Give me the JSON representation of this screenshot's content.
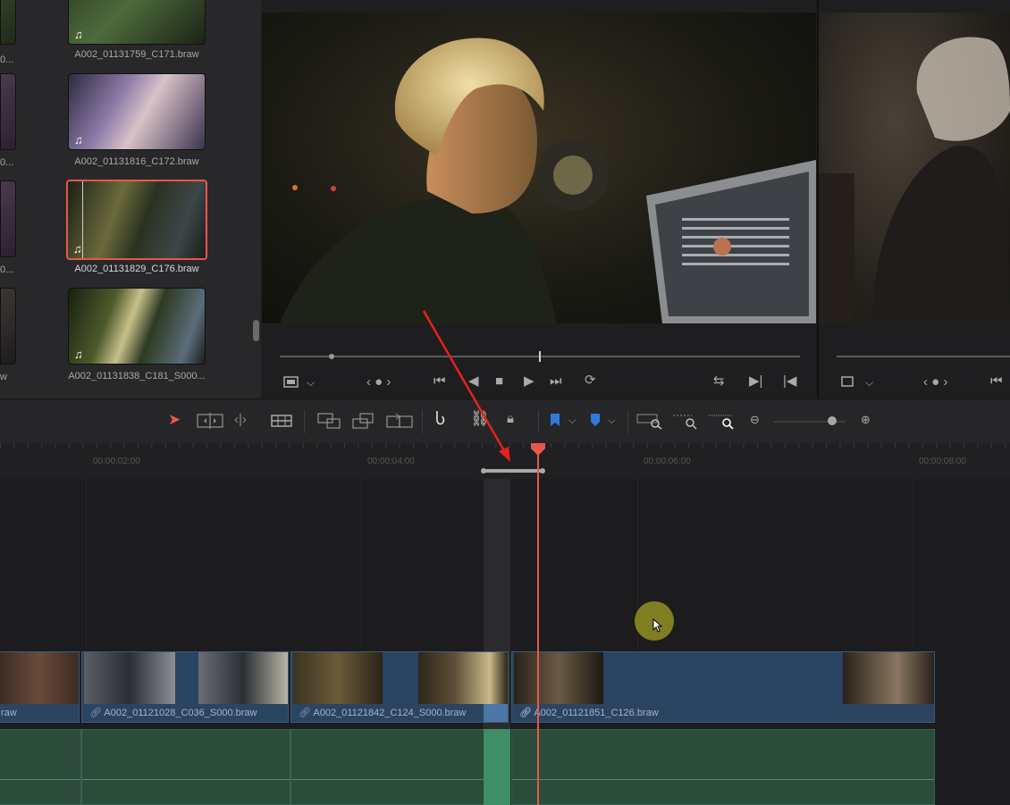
{
  "media_pool": {
    "clips": [
      {
        "name": "A002_01131759_C171.braw"
      },
      {
        "name": "A002_01131816_C172.braw"
      },
      {
        "name": "A002_01131829_C176.braw",
        "selected": true
      },
      {
        "name": "A002_01131838_C181_S000..."
      }
    ],
    "left_column_labels": [
      "0...",
      "0...",
      "0...",
      "w"
    ]
  },
  "timeline": {
    "timecodes": [
      "00:00:02:00",
      "00:00:04:00",
      "00:00:06:00",
      "00:00:08:00"
    ],
    "video_clips": [
      {
        "name": "raw"
      },
      {
        "name": "A002_01121028_C036_S000.braw"
      },
      {
        "name": "A002_01121842_C124_S000.braw"
      },
      {
        "name": "A002_01121851_C126.braw"
      }
    ]
  },
  "colors": {
    "accent": "#e8574a",
    "video_clip": "#2a4461",
    "audio_clip": "#2b4b3b",
    "marker_blue": "#2f7ad8",
    "cursor_highlight": "#8b8a22"
  },
  "icons": [
    "music-note-icon",
    "select-arrow-icon",
    "trim-icon",
    "dynamic-trim-icon",
    "blade-icon",
    "insert-icon",
    "overwrite-icon",
    "replace-icon",
    "snapping-icon",
    "linked-selection-icon",
    "lock-icon",
    "flag-icon",
    "marker-icon",
    "zoom-full-icon",
    "zoom-detail-icon",
    "zoom-custom-icon",
    "play-icon",
    "stop-icon",
    "loop-icon"
  ]
}
